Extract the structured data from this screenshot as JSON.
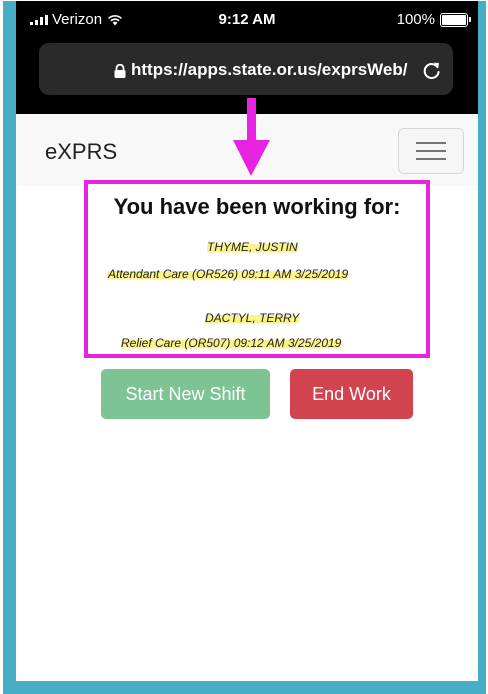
{
  "status_bar": {
    "carrier": "Verizon",
    "time": "9:12 AM",
    "battery": "100%"
  },
  "browser": {
    "url": "https://apps.state.or.us/exprsWeb/"
  },
  "navbar": {
    "brand": "eXPRS"
  },
  "working": {
    "heading": "You have been working for:",
    "entries": [
      {
        "name": "THYME, JUSTIN",
        "detail": "Attendant Care (OR526)  09:11 AM 3/25/2019"
      },
      {
        "name": "DACTYL, TERRY",
        "detail": "Relief Care (OR507)  09:12 AM 3/25/2019"
      }
    ]
  },
  "actions": {
    "start_label": "Start New Shift",
    "end_label": "End Work"
  },
  "colors": {
    "frame": "#47acc6",
    "annotation": "#e623e0",
    "highlight": "#fbf38a",
    "start_button": "#7ec394",
    "end_button": "#d1434e"
  }
}
